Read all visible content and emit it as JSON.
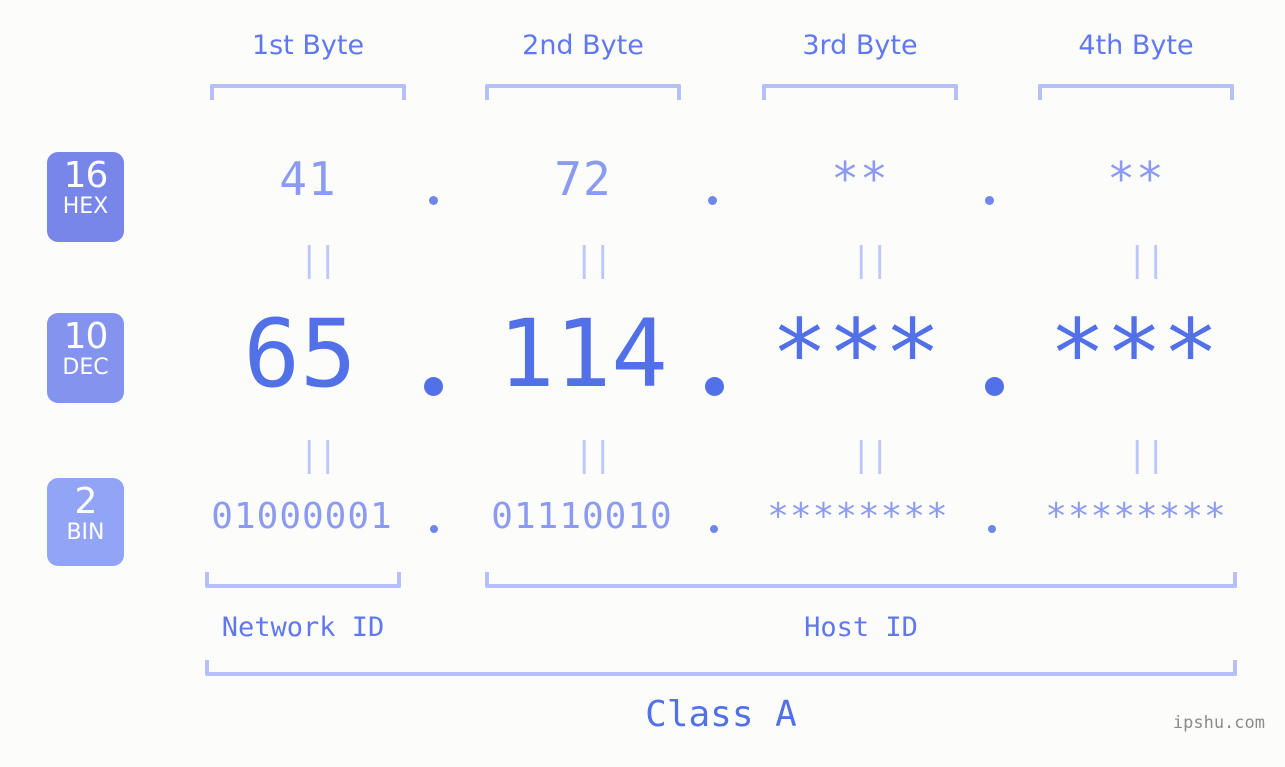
{
  "background_color": "#fcfdfa",
  "accent_colors": {
    "header_text": "#5f78ef",
    "bracket": "#b5c0fb",
    "hex_value": "#8c9bf2",
    "dec_value": "#5271e8",
    "bin_value": "#8c9bf2",
    "equals_mark": "#bdc7fc",
    "badge_hex": "#7786e8",
    "badge_dec": "#8393ee",
    "badge_bin": "#92a4f5",
    "watermark": "#8b8b8b"
  },
  "byte_headers": [
    {
      "label": "1st Byte"
    },
    {
      "label": "2nd Byte"
    },
    {
      "label": "3rd Byte"
    },
    {
      "label": "4th Byte"
    }
  ],
  "bases": [
    {
      "number": "16",
      "abbr": "HEX"
    },
    {
      "number": "10",
      "abbr": "DEC"
    },
    {
      "number": "2",
      "abbr": "BIN"
    }
  ],
  "rows": {
    "hex": {
      "base_number": "16",
      "base_abbr": "HEX",
      "values": [
        "41",
        "72",
        "**",
        "**"
      ],
      "separator": "."
    },
    "dec": {
      "base_number": "10",
      "base_abbr": "DEC",
      "values": [
        "65",
        "114",
        "***",
        "***"
      ],
      "separator": "."
    },
    "bin": {
      "base_number": "2",
      "base_abbr": "BIN",
      "values": [
        "01000001",
        "01110010",
        "********",
        "********"
      ],
      "separator": "."
    }
  },
  "equals_marks": {
    "glyph": "||",
    "count_per_gap": 4
  },
  "sections": [
    {
      "label": "Network ID"
    },
    {
      "label": "Host ID"
    }
  ],
  "class_label": "Class A",
  "watermark": "ipshu.com"
}
